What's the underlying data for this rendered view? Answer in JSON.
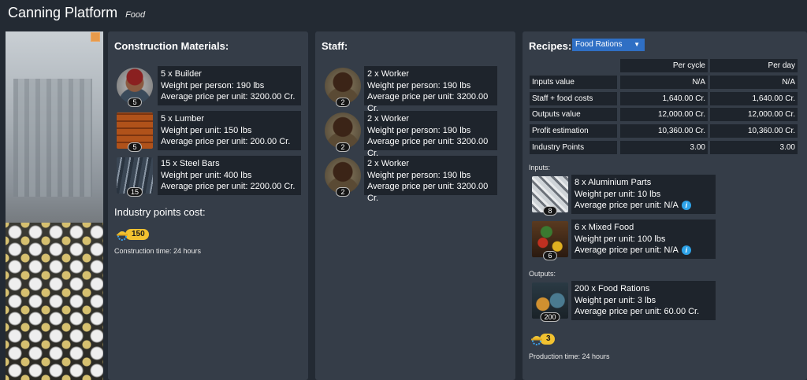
{
  "header": {
    "title": "Canning Platform",
    "category": "Food"
  },
  "colors": {
    "background": "#232a33",
    "panel": "#353d48",
    "cell": "#1e242c",
    "accent": "#2f6fc4",
    "badge": "#f2c230",
    "info": "#2ea3e8",
    "hero_badge": "#e89a4a"
  },
  "construction": {
    "title": "Construction Materials:",
    "items": [
      {
        "icon": "builder-portrait",
        "count": "5",
        "name": "5 x Builder",
        "weight": "Weight per person: 190 lbs",
        "price": "Average price per unit: 3200.00 Cr."
      },
      {
        "icon": "lumber-image",
        "count": "5",
        "name": "5 x Lumber",
        "weight": "Weight per unit: 150 lbs",
        "price": "Average price per unit: 200.00 Cr."
      },
      {
        "icon": "steel-bars-image",
        "count": "15",
        "name": "15 x Steel Bars",
        "weight": "Weight per unit: 400 lbs",
        "price": "Average price per unit: 2200.00 Cr."
      }
    ],
    "industry_points_label": "Industry points cost:",
    "industry_points_value": "150",
    "construction_time": "Construction time: 24 hours"
  },
  "staff": {
    "title": "Staff:",
    "items": [
      {
        "icon": "worker-portrait",
        "count": "2",
        "name": "2 x Worker",
        "weight": "Weight per person: 190 lbs",
        "price": "Average price per unit: 3200.00 Cr."
      },
      {
        "icon": "worker-portrait",
        "count": "2",
        "name": "2 x Worker",
        "weight": "Weight per person: 190 lbs",
        "price": "Average price per unit: 3200.00 Cr."
      },
      {
        "icon": "worker-portrait",
        "count": "2",
        "name": "2 x Worker",
        "weight": "Weight per person: 190 lbs",
        "price": "Average price per unit: 3200.00 Cr."
      }
    ]
  },
  "recipes": {
    "title": "Recipes:",
    "selected": "Food Rations",
    "table": {
      "headers": [
        "Per cycle",
        "Per day"
      ],
      "rows": [
        {
          "label": "Inputs value",
          "cycle": "N/A",
          "day": "N/A"
        },
        {
          "label": "Staff + food costs",
          "cycle": "1,640.00 Cr.",
          "day": "1,640.00 Cr."
        },
        {
          "label": "Outputs value",
          "cycle": "12,000.00 Cr.",
          "day": "12,000.00 Cr."
        },
        {
          "label": "Profit estimation",
          "cycle": "10,360.00 Cr.",
          "day": "10,360.00 Cr."
        },
        {
          "label": "Industry Points",
          "cycle": "3.00",
          "day": "3.00"
        }
      ]
    },
    "inputs_label": "Inputs:",
    "inputs": [
      {
        "icon": "aluminium-parts-image",
        "count": "8",
        "name": "8 x Aluminium Parts",
        "weight": "Weight per unit: 10 lbs",
        "price": "Average price per unit: N/A"
      },
      {
        "icon": "mixed-food-image",
        "count": "6",
        "name": "6 x Mixed Food",
        "weight": "Weight per unit: 100 lbs",
        "price": "Average price per unit: N/A"
      }
    ],
    "outputs_label": "Outputs:",
    "outputs": [
      {
        "icon": "food-rations-image",
        "count": "200",
        "name": "200 x Food Rations",
        "weight": "Weight per unit: 3 lbs",
        "price": "Average price per unit: 60.00 Cr."
      }
    ],
    "industry_points_value": "3",
    "production_time": "Production time: 24 hours"
  }
}
